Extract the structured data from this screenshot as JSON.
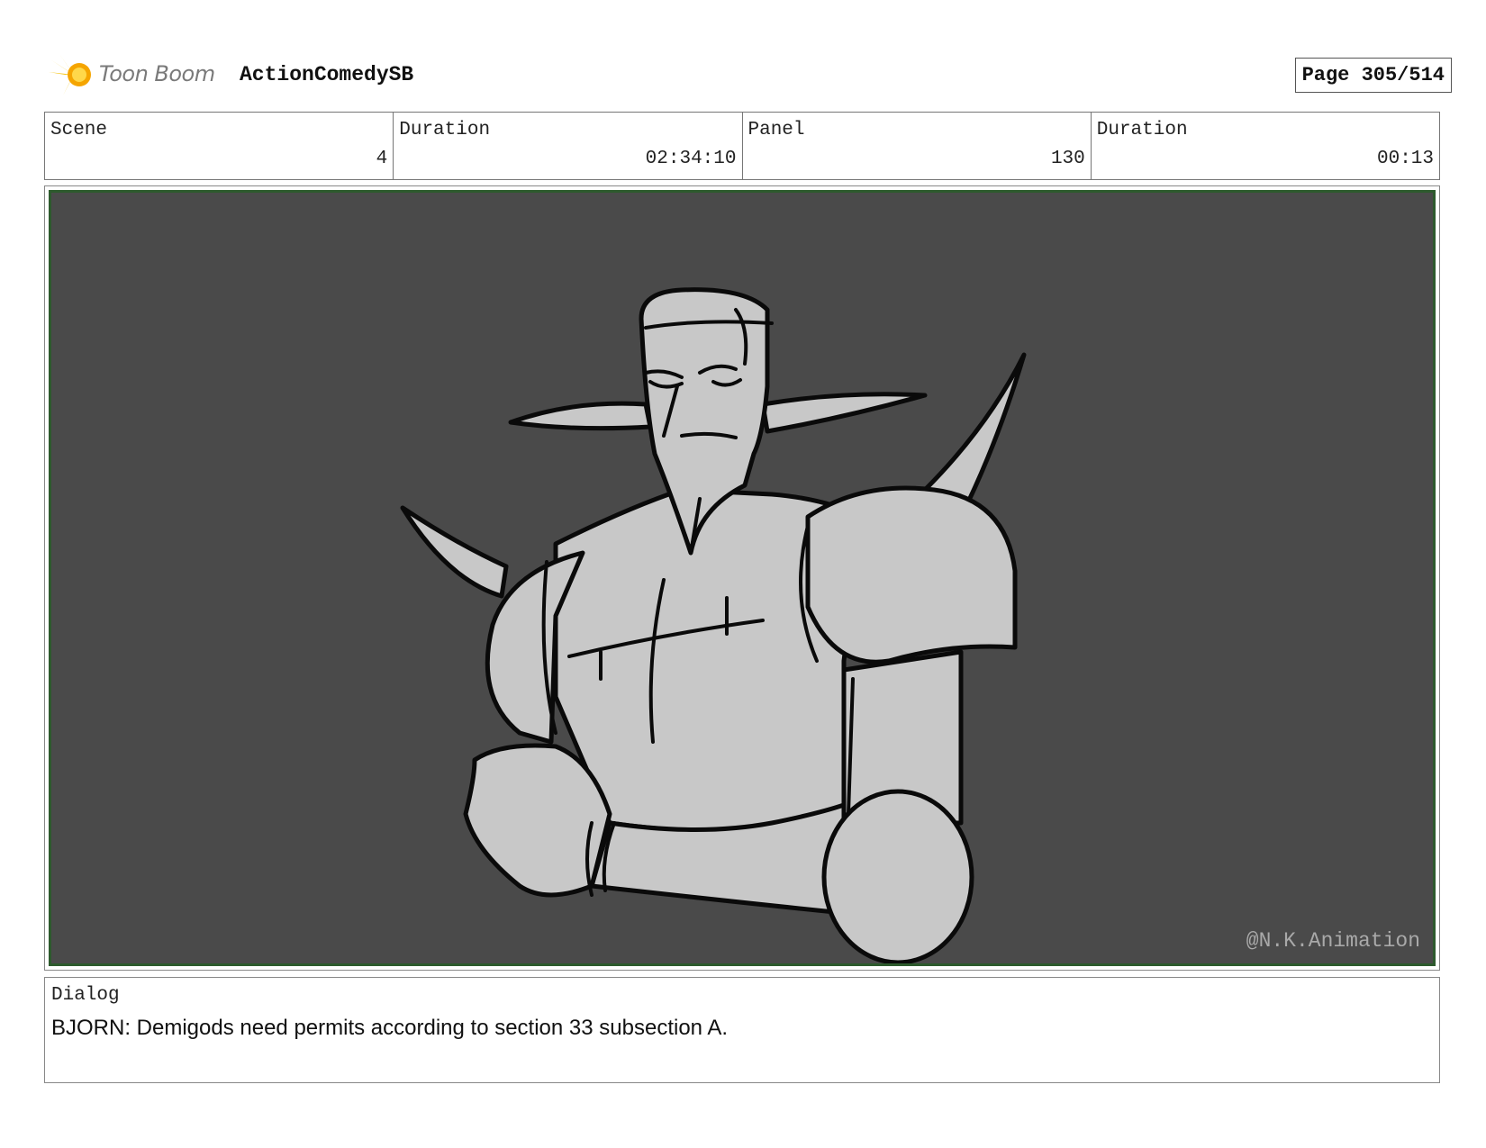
{
  "header": {
    "brand": "Toon Boom",
    "project": "ActionComedySB",
    "page": "Page 305/514"
  },
  "info": [
    {
      "label": "Scene",
      "value": "4"
    },
    {
      "label": "Duration",
      "value": "02:34:10"
    },
    {
      "label": "Panel",
      "value": "130"
    },
    {
      "label": "Duration",
      "value": "00:13"
    }
  ],
  "panel": {
    "watermark": "@N.K.Animation",
    "background_color": "#4a4a4a",
    "figure_color": "#c8c8c8",
    "border_color": "#2d5a2d"
  },
  "dialog": {
    "label": "Dialog",
    "text": "BJORN: Demigods need permits according to section 33 subsection A."
  }
}
